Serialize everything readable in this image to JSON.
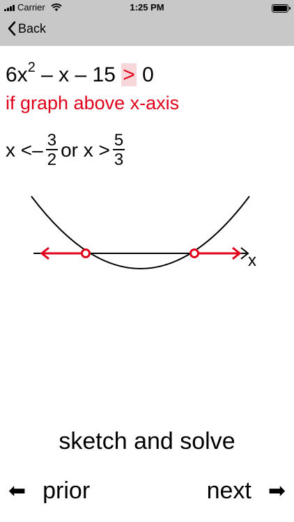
{
  "status": {
    "carrier": "Carrier",
    "time": "1:25 PM"
  },
  "nav": {
    "back_label": "Back"
  },
  "problem": {
    "equation_main": "6x",
    "equation_exp": "2",
    "equation_rest": " – x – 15 ",
    "equation_op": ">",
    "equation_end": " 0",
    "condition": "if graph above x-axis",
    "solution_x1": "x <",
    "solution_neg": "–",
    "frac1_num": "3",
    "frac1_den": "2",
    "solution_or": "or x >",
    "frac2_num": "5",
    "frac2_den": "3"
  },
  "graph": {
    "x_label": "x"
  },
  "footer": {
    "title": "sketch and solve",
    "prior_label": "prior",
    "next_label": "next"
  },
  "colors": {
    "accent": "#e0001a",
    "highlight": "#f7d7da",
    "bar": "#c8c8c8"
  }
}
